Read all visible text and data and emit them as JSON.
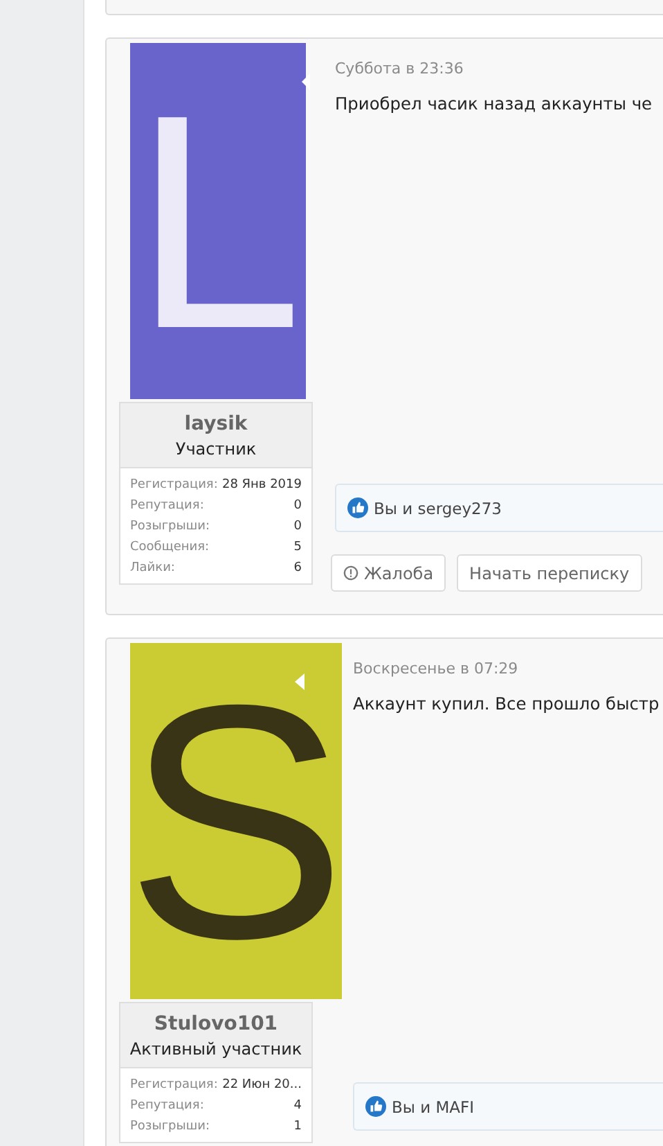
{
  "posts": [
    {
      "avatar": {
        "letter": "L",
        "color": "#6864cc"
      },
      "username": "laysik",
      "rank": "Участник",
      "stats": [
        {
          "label": "Регистрация:",
          "value": "28 Янв 2019"
        },
        {
          "label": "Репутация:",
          "value": "0"
        },
        {
          "label": "Розыгрыши:",
          "value": "0"
        },
        {
          "label": "Сообщения:",
          "value": "5"
        },
        {
          "label": "Лайки:",
          "value": "6"
        }
      ],
      "date": "Суббота в 23:36",
      "text": "Приобрел часик назад аккаунты че",
      "likes": "Вы и sergey273",
      "actions": [
        {
          "kind": "report",
          "label": "Жалоба"
        },
        {
          "kind": "plain",
          "label": "Начать переписку"
        }
      ]
    },
    {
      "avatar": {
        "letter": "S",
        "color": "#cbcb33"
      },
      "username": "Stulovo101",
      "rank": "Активный участник",
      "stats": [
        {
          "label": "Регистрация:",
          "value": "22 Июн 20..."
        },
        {
          "label": "Репутация:",
          "value": "4"
        },
        {
          "label": "Розыгрыши:",
          "value": "1"
        }
      ],
      "date": "Воскресенье в 07:29",
      "text": "Аккаунт купил. Все прошло быстр",
      "likes": "Вы и MAFI"
    }
  ]
}
